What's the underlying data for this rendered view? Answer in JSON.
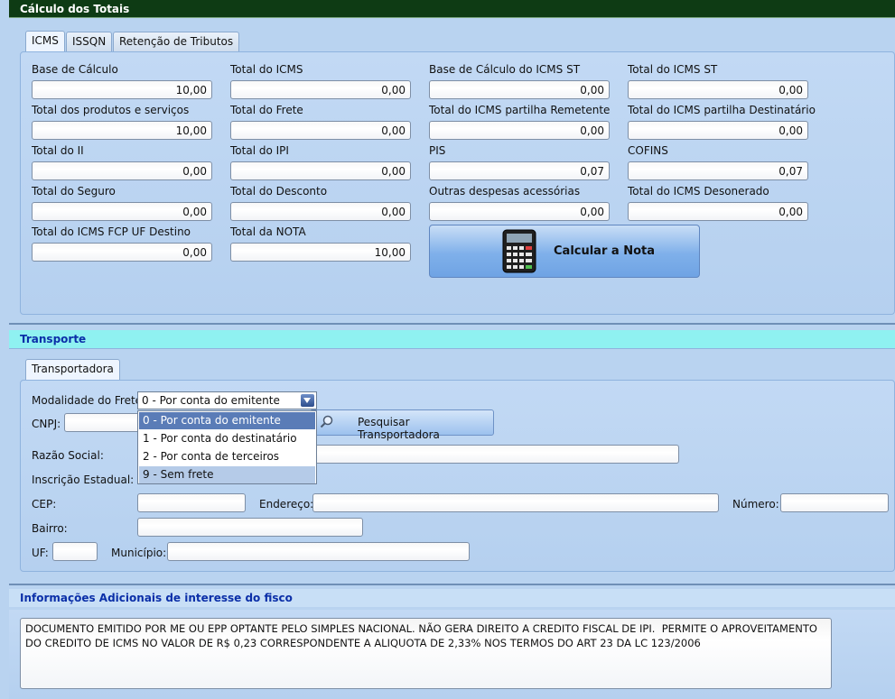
{
  "calc": {
    "title": "Cálculo dos Totais",
    "tabs": [
      "ICMS",
      "ISSQN",
      "Retenção de Tributos"
    ],
    "fields": [
      {
        "label": "Base de Cálculo",
        "value": "10,00"
      },
      {
        "label": "Total do ICMS",
        "value": "0,00"
      },
      {
        "label": "Base de Cálculo do ICMS ST",
        "value": "0,00"
      },
      {
        "label": "Total do ICMS ST",
        "value": "0,00"
      },
      {
        "label": "Total dos produtos e serviços",
        "value": "10,00"
      },
      {
        "label": "Total do Frete",
        "value": "0,00"
      },
      {
        "label": "Total do ICMS partilha Remetente",
        "value": "0,00"
      },
      {
        "label": "Total do ICMS partilha Destinatário",
        "value": "0,00"
      },
      {
        "label": "Total do II",
        "value": "0,00"
      },
      {
        "label": "Total do IPI",
        "value": "0,00"
      },
      {
        "label": "PIS",
        "value": "0,07"
      },
      {
        "label": "COFINS",
        "value": "0,07"
      },
      {
        "label": "Total do Seguro",
        "value": "0,00"
      },
      {
        "label": "Total do Desconto",
        "value": "0,00"
      },
      {
        "label": "Outras despesas acessórias",
        "value": "0,00"
      },
      {
        "label": "Total do ICMS Desonerado",
        "value": "0,00"
      },
      {
        "label": "Total do ICMS FCP UF Destino",
        "value": "0,00"
      },
      {
        "label": "Total da NOTA",
        "value": "10,00"
      }
    ],
    "calc_button": "Calcular a Nota",
    "calc_icon": "calculator-icon"
  },
  "transporte": {
    "title": "Transporte",
    "tab": "Transportadora",
    "modalidade_label": "Modalidade do Frete:",
    "modalidade_value": "0 - Por conta do emitente",
    "options": [
      "0 - Por conta do emitente",
      "1 - Por conta do destinatário",
      "2 - Por conta de terceiros",
      "9 - Sem frete"
    ],
    "cnpj_label": "CNPJ:",
    "search_button": "Pesquisar Transportadora",
    "search_icon": "search-icon",
    "razao_label": "Razão Social:",
    "ie_label": "Inscrição Estadual:",
    "cep_label": "CEP:",
    "endereco_label": "Endereço:",
    "numero_label": "Número:",
    "bairro_label": "Bairro:",
    "uf_label": "UF:",
    "municipio_label": "Município:"
  },
  "info": {
    "title": "Informações Adicionais de interesse do fisco",
    "text": "DOCUMENTO EMITIDO POR ME OU EPP OPTANTE PELO SIMPLES NACIONAL. NÃO GERA DIREITO A CREDITO FISCAL DE IPI.  PERMITE O APROVEITAMENTO DO CREDITO DE ICMS NO VALOR DE R$ 0,23 CORRESPONDENTE A ALIQUOTA DE 2,33% NOS TERMOS DO ART 23 DA LC 123/2006"
  },
  "colors": {
    "header_dark": "#0e3b14",
    "section_cyan": "#8ff1f1",
    "section_title": "#0b2fa8",
    "selected_option": "#5a7cb7"
  }
}
